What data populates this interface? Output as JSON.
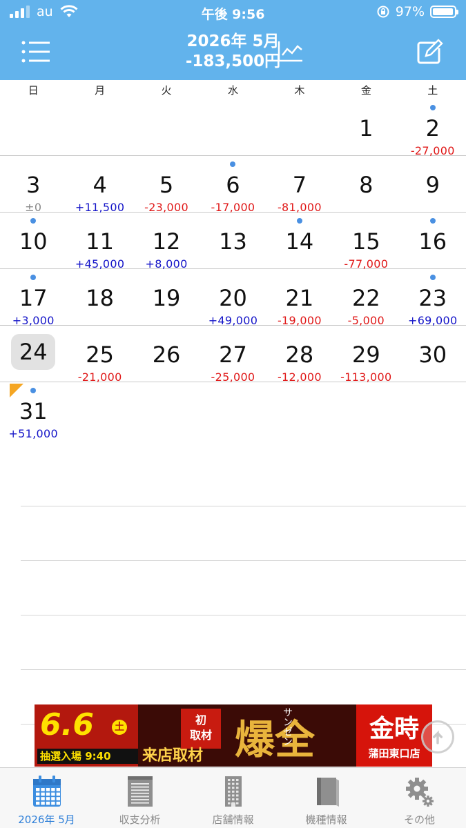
{
  "status_bar": {
    "carrier": "au",
    "time": "午後 9:56",
    "battery": "97%",
    "battery_level": 0.97
  },
  "header": {
    "title": "2026年 5月",
    "total": "-183,500円",
    "menu_icon": "list-icon",
    "chart_icon": "line-chart-icon",
    "edit_icon": "compose-icon"
  },
  "colors": {
    "accent": "#62b3ec",
    "positive": "#1515c8",
    "negative": "#e01818",
    "neutral": "#8a8a8a",
    "dot": "#4a90e2",
    "today_bg": "#e2e2e2",
    "marker": "#f5a623"
  },
  "weekdays": [
    "日",
    "月",
    "火",
    "水",
    "木",
    "金",
    "土"
  ],
  "weeks": [
    [
      {
        "day": "",
        "amount": "",
        "sign": "",
        "dot": false
      },
      {
        "day": "",
        "amount": "",
        "sign": "",
        "dot": false
      },
      {
        "day": "",
        "amount": "",
        "sign": "",
        "dot": false
      },
      {
        "day": "",
        "amount": "",
        "sign": "",
        "dot": false
      },
      {
        "day": "",
        "amount": "",
        "sign": "",
        "dot": false
      },
      {
        "day": "1",
        "amount": "",
        "sign": "",
        "dot": false
      },
      {
        "day": "2",
        "amount": "-27,000",
        "sign": "neg",
        "dot": true
      }
    ],
    [
      {
        "day": "3",
        "amount": "±0",
        "sign": "zero",
        "dot": false
      },
      {
        "day": "4",
        "amount": "+11,500",
        "sign": "pos",
        "dot": false
      },
      {
        "day": "5",
        "amount": "-23,000",
        "sign": "neg",
        "dot": false
      },
      {
        "day": "6",
        "amount": "-17,000",
        "sign": "neg",
        "dot": true
      },
      {
        "day": "7",
        "amount": "-81,000",
        "sign": "neg",
        "dot": false
      },
      {
        "day": "8",
        "amount": "",
        "sign": "",
        "dot": false
      },
      {
        "day": "9",
        "amount": "",
        "sign": "",
        "dot": false
      }
    ],
    [
      {
        "day": "10",
        "amount": "",
        "sign": "",
        "dot": true
      },
      {
        "day": "11",
        "amount": "+45,000",
        "sign": "pos",
        "dot": false
      },
      {
        "day": "12",
        "amount": "+8,000",
        "sign": "pos",
        "dot": false
      },
      {
        "day": "13",
        "amount": "",
        "sign": "",
        "dot": false
      },
      {
        "day": "14",
        "amount": "",
        "sign": "",
        "dot": true
      },
      {
        "day": "15",
        "amount": "-77,000",
        "sign": "neg",
        "dot": false
      },
      {
        "day": "16",
        "amount": "",
        "sign": "",
        "dot": true
      }
    ],
    [
      {
        "day": "17",
        "amount": "+3,000",
        "sign": "pos",
        "dot": true
      },
      {
        "day": "18",
        "amount": "",
        "sign": "",
        "dot": false
      },
      {
        "day": "19",
        "amount": "",
        "sign": "",
        "dot": false
      },
      {
        "day": "20",
        "amount": "+49,000",
        "sign": "pos",
        "dot": false
      },
      {
        "day": "21",
        "amount": "-19,000",
        "sign": "neg",
        "dot": false
      },
      {
        "day": "22",
        "amount": "-5,000",
        "sign": "neg",
        "dot": false
      },
      {
        "day": "23",
        "amount": "+69,000",
        "sign": "pos",
        "dot": true
      }
    ],
    [
      {
        "day": "24",
        "amount": "",
        "sign": "",
        "dot": false,
        "today": true
      },
      {
        "day": "25",
        "amount": "-21,000",
        "sign": "neg",
        "dot": false
      },
      {
        "day": "26",
        "amount": "",
        "sign": "",
        "dot": false
      },
      {
        "day": "27",
        "amount": "-25,000",
        "sign": "neg",
        "dot": false
      },
      {
        "day": "28",
        "amount": "-12,000",
        "sign": "neg",
        "dot": false
      },
      {
        "day": "29",
        "amount": "-113,000",
        "sign": "neg",
        "dot": false
      },
      {
        "day": "30",
        "amount": "",
        "sign": "",
        "dot": false
      }
    ],
    [
      {
        "day": "31",
        "amount": "+51,000",
        "sign": "pos",
        "dot": true,
        "corner": true
      }
    ]
  ],
  "ad": {
    "date": "6.6",
    "weekday": "土",
    "lottery": "抽選入場 9:40",
    "tag_line1": "初",
    "tag_line2": "取材",
    "visit": "来店取材",
    "big_kanji": "爆全",
    "katakana": "サンゼン",
    "store": "金時",
    "branch": "蒲田東口店"
  },
  "tabs": [
    {
      "label": "2026年 5月",
      "icon": "calendar-icon",
      "active": true
    },
    {
      "label": "収支分析",
      "icon": "notepad-icon",
      "active": false
    },
    {
      "label": "店舗情報",
      "icon": "building-icon",
      "active": false
    },
    {
      "label": "機種情報",
      "icon": "book-icon",
      "active": false
    },
    {
      "label": "その他",
      "icon": "gear-icon",
      "active": false
    }
  ]
}
